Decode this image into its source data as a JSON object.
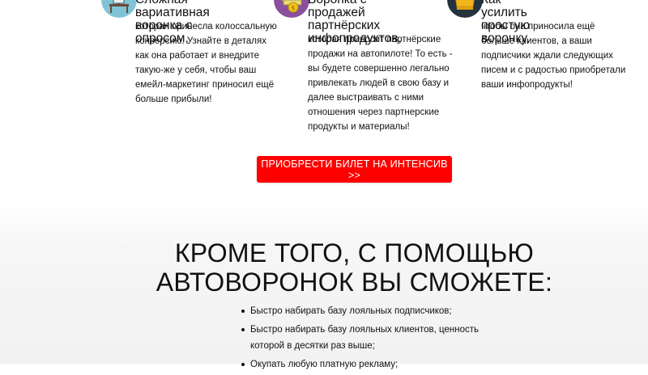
{
  "features": [
    {
      "heading": "Сложная вариативная воронка с опросом,",
      "body": "которая принесла колоссальную конверсию. Узнайте в деталях как она работает и внедрите такую-же у себя, чтобы ваш емейл-маркетинг приносил ещё больше прибыли!",
      "icon": "desk-icon"
    },
    {
      "heading": "Воронка с продажей партнёрских инфопродуктов,",
      "body": "которая приносит партнёрские продажи на автопилоте! То есть - вы будете совершенно легально привлекать людей в свою базу и далее выстраивать с ними отношения через партнерские продукты и материалы!",
      "icon": "money-icon"
    },
    {
      "heading": "Как усилить простую воронку,",
      "body": "чтобы она приносила ещё больше клиентов, а ваши подписчики ждали следующих писем и с радостью приобретали ваши инфопродукты!",
      "icon": "crown-icon"
    }
  ],
  "cta": {
    "label": "ПРИОБРЕСТИ БИЛЕТ НА ИНТЕНСИВ >>"
  },
  "section": {
    "title_line1": "КРОМЕ ТОГО, С ПОМОЩЬЮ",
    "title_line2": "АВТОВОРОНОК ВЫ СМОЖЕТЕ:",
    "benefits": [
      "Быстро набирать базу лояльных подписчиков;",
      "Быстро набирать базу лояльных клиентов, ценность которой в десятки раз выше;",
      "Окупать любую платную рекламу;"
    ]
  },
  "colors": {
    "cta_bg": "#ff0000",
    "icon_desk_bg": "#7fc4d6",
    "icon_money_bg": "#8a4f9e",
    "icon_crown_bg": "#25323f",
    "crown_gold": "#f3b51c"
  }
}
